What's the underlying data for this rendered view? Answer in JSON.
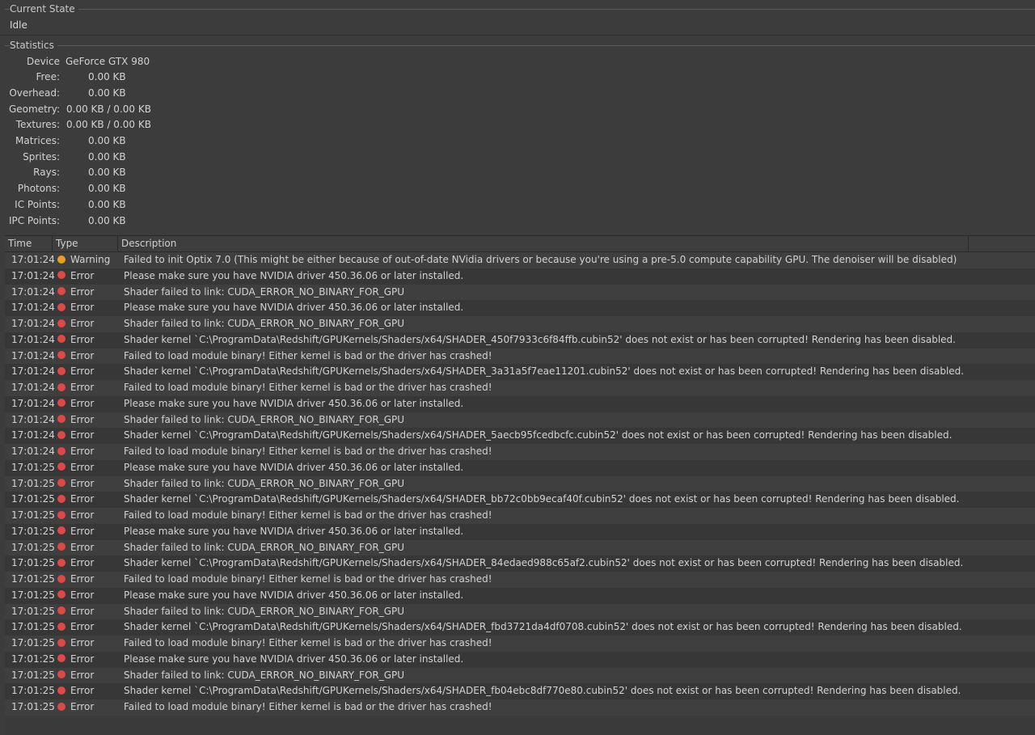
{
  "current_state": {
    "title": "Current State",
    "value": "Idle"
  },
  "statistics": {
    "title": "Statistics",
    "rows": [
      {
        "label": "Device",
        "value": "GeForce GTX 980"
      },
      {
        "label": "Free:",
        "value": "0.00 KB"
      },
      {
        "label": "Overhead:",
        "value": "0.00 KB"
      },
      {
        "label": "Geometry:",
        "value": "0.00 KB / 0.00 KB"
      },
      {
        "label": "Textures:",
        "value": "0.00 KB / 0.00 KB"
      },
      {
        "label": "Matrices:",
        "value": "0.00 KB"
      },
      {
        "label": "Sprites:",
        "value": "0.00 KB"
      },
      {
        "label": "Rays:",
        "value": "0.00 KB"
      },
      {
        "label": "Photons:",
        "value": "0.00 KB"
      },
      {
        "label": "IC Points:",
        "value": "0.00 KB"
      },
      {
        "label": "IPC Points:",
        "value": "0.00 KB"
      }
    ]
  },
  "log": {
    "columns": {
      "time": "Time",
      "type": "Type",
      "description": "Description"
    },
    "colors": {
      "error": "#e04848",
      "warning": "#e8a020"
    },
    "rows": [
      {
        "time": "17:01:24",
        "type": "Warning",
        "desc": "Failed to init Optix 7.0 (This might be either because of out-of-date NVidia drivers or because you're using a pre-5.0 compute capability GPU. The denoiser will be disabled)"
      },
      {
        "time": "17:01:24",
        "type": "Error",
        "desc": "Please make sure you have NVIDIA driver 450.36.06 or later installed."
      },
      {
        "time": "17:01:24",
        "type": "Error",
        "desc": "Shader failed to link: CUDA_ERROR_NO_BINARY_FOR_GPU"
      },
      {
        "time": "17:01:24",
        "type": "Error",
        "desc": "Please make sure you have NVIDIA driver 450.36.06 or later installed."
      },
      {
        "time": "17:01:24",
        "type": "Error",
        "desc": "Shader failed to link: CUDA_ERROR_NO_BINARY_FOR_GPU"
      },
      {
        "time": "17:01:24",
        "type": "Error",
        "desc": "Shader kernel `C:\\ProgramData\\Redshift/GPUKernels/Shaders/x64/SHADER_450f7933c6f84ffb.cubin52' does not exist or has been corrupted! Rendering has been disabled."
      },
      {
        "time": "17:01:24",
        "type": "Error",
        "desc": "Failed to load module binary! Either kernel is bad or the driver has crashed!"
      },
      {
        "time": "17:01:24",
        "type": "Error",
        "desc": "Shader kernel `C:\\ProgramData\\Redshift/GPUKernels/Shaders/x64/SHADER_3a31a5f7eae11201.cubin52' does not exist or has been corrupted! Rendering has been disabled."
      },
      {
        "time": "17:01:24",
        "type": "Error",
        "desc": "Failed to load module binary! Either kernel is bad or the driver has crashed!"
      },
      {
        "time": "17:01:24",
        "type": "Error",
        "desc": "Please make sure you have NVIDIA driver 450.36.06 or later installed."
      },
      {
        "time": "17:01:24",
        "type": "Error",
        "desc": "Shader failed to link: CUDA_ERROR_NO_BINARY_FOR_GPU"
      },
      {
        "time": "17:01:24",
        "type": "Error",
        "desc": "Shader kernel `C:\\ProgramData\\Redshift/GPUKernels/Shaders/x64/SHADER_5aecb95fcedbcfc.cubin52' does not exist or has been corrupted! Rendering has been disabled."
      },
      {
        "time": "17:01:24",
        "type": "Error",
        "desc": "Failed to load module binary! Either kernel is bad or the driver has crashed!"
      },
      {
        "time": "17:01:25",
        "type": "Error",
        "desc": "Please make sure you have NVIDIA driver 450.36.06 or later installed."
      },
      {
        "time": "17:01:25",
        "type": "Error",
        "desc": "Shader failed to link: CUDA_ERROR_NO_BINARY_FOR_GPU"
      },
      {
        "time": "17:01:25",
        "type": "Error",
        "desc": "Shader kernel `C:\\ProgramData\\Redshift/GPUKernels/Shaders/x64/SHADER_bb72c0bb9ecaf40f.cubin52' does not exist or has been corrupted! Rendering has been disabled."
      },
      {
        "time": "17:01:25",
        "type": "Error",
        "desc": "Failed to load module binary! Either kernel is bad or the driver has crashed!"
      },
      {
        "time": "17:01:25",
        "type": "Error",
        "desc": "Please make sure you have NVIDIA driver 450.36.06 or later installed."
      },
      {
        "time": "17:01:25",
        "type": "Error",
        "desc": "Shader failed to link: CUDA_ERROR_NO_BINARY_FOR_GPU"
      },
      {
        "time": "17:01:25",
        "type": "Error",
        "desc": "Shader kernel `C:\\ProgramData\\Redshift/GPUKernels/Shaders/x64/SHADER_84edaed988c65af2.cubin52' does not exist or has been corrupted! Rendering has been disabled."
      },
      {
        "time": "17:01:25",
        "type": "Error",
        "desc": "Failed to load module binary! Either kernel is bad or the driver has crashed!"
      },
      {
        "time": "17:01:25",
        "type": "Error",
        "desc": "Please make sure you have NVIDIA driver 450.36.06 or later installed."
      },
      {
        "time": "17:01:25",
        "type": "Error",
        "desc": "Shader failed to link: CUDA_ERROR_NO_BINARY_FOR_GPU"
      },
      {
        "time": "17:01:25",
        "type": "Error",
        "desc": "Shader kernel `C:\\ProgramData\\Redshift/GPUKernels/Shaders/x64/SHADER_fbd3721da4df0708.cubin52' does not exist or has been corrupted! Rendering has been disabled."
      },
      {
        "time": "17:01:25",
        "type": "Error",
        "desc": "Failed to load module binary! Either kernel is bad or the driver has crashed!"
      },
      {
        "time": "17:01:25",
        "type": "Error",
        "desc": "Please make sure you have NVIDIA driver 450.36.06 or later installed."
      },
      {
        "time": "17:01:25",
        "type": "Error",
        "desc": "Shader failed to link: CUDA_ERROR_NO_BINARY_FOR_GPU"
      },
      {
        "time": "17:01:25",
        "type": "Error",
        "desc": "Shader kernel `C:\\ProgramData\\Redshift/GPUKernels/Shaders/x64/SHADER_fb04ebc8df770e80.cubin52' does not exist or has been corrupted! Rendering has been disabled."
      },
      {
        "time": "17:01:25",
        "type": "Error",
        "desc": "Failed to load module binary! Either kernel is bad or the driver has crashed!"
      }
    ]
  }
}
